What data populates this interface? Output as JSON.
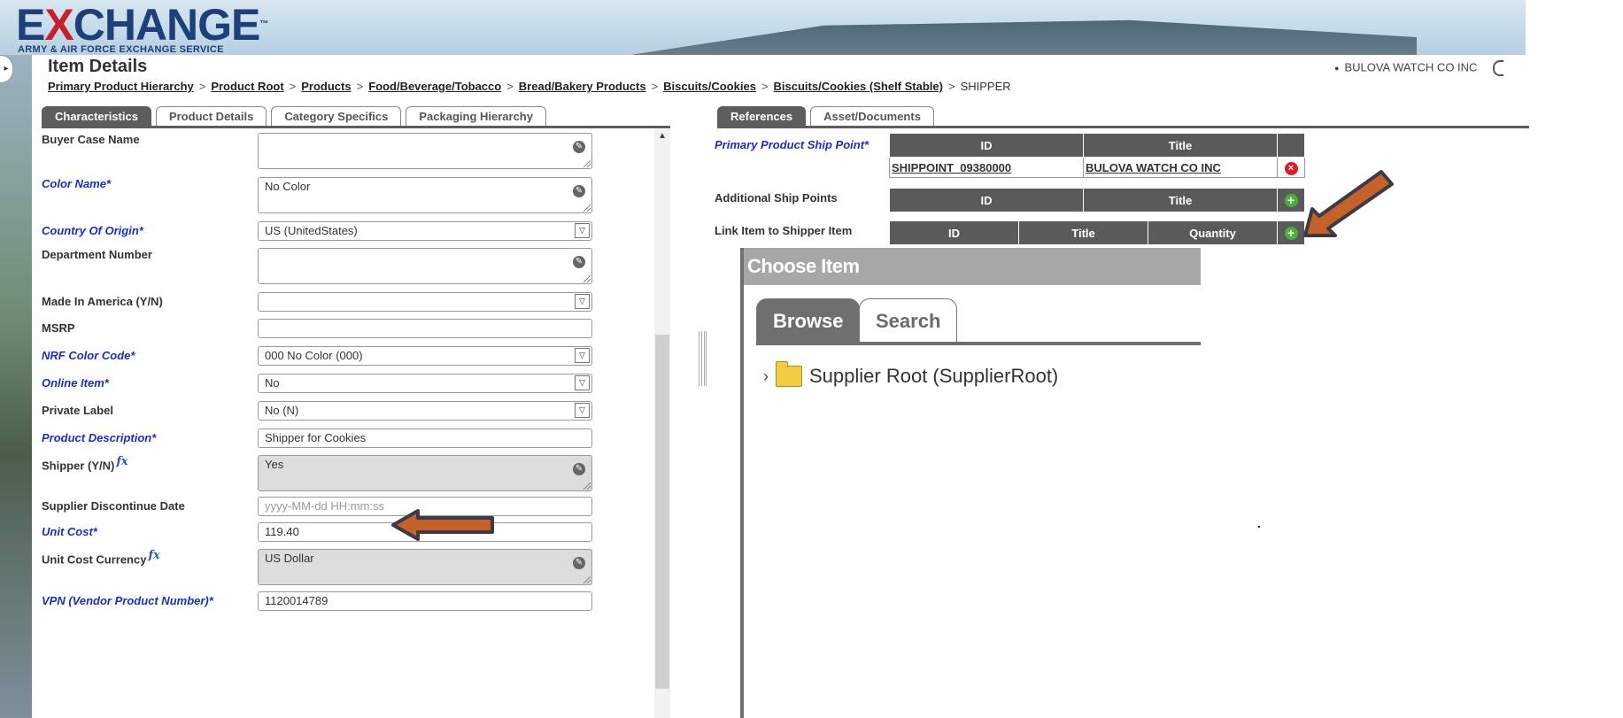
{
  "brand": {
    "logo_pre": "E",
    "logo_x": "X",
    "logo_post": "CHANGE",
    "logo_tm": "™",
    "subtitle": "ARMY & AIR FORCE EXCHANGE SERVICE"
  },
  "page": {
    "title": "Item Details",
    "supplier": "BULOVA WATCH CO INC"
  },
  "breadcrumb": [
    "Primary Product Hierarchy",
    "Product Root",
    "Products",
    "Food/Beverage/Tobacco",
    "Bread/Bakery Products",
    "Biscuits/Cookies",
    "Biscuits/Cookies (Shelf Stable)"
  ],
  "breadcrumb_current": "SHIPPER",
  "left_tabs": [
    "Characteristics",
    "Product Details",
    "Category Specifics",
    "Packaging Hierarchy"
  ],
  "right_tabs": [
    "References",
    "Asset/Documents"
  ],
  "fields": [
    {
      "label": "Buyer Case Name",
      "value": ""
    },
    {
      "label": "Color Name*",
      "value": "No Color"
    },
    {
      "label": "Country Of Origin*",
      "value": "US (UnitedStates)"
    },
    {
      "label": "Department Number",
      "value": ""
    },
    {
      "label": "Made In America (Y/N)",
      "value": ""
    },
    {
      "label": "MSRP",
      "value": ""
    },
    {
      "label": "NRF Color Code*",
      "value": "000 No Color (000)"
    },
    {
      "label": "Online Item*",
      "value": "No"
    },
    {
      "label": "Private Label",
      "value": "No (N)"
    },
    {
      "label": "Product Description*",
      "value": "Shipper for Cookies"
    },
    {
      "label": "Shipper (Y/N)",
      "value": "Yes"
    },
    {
      "label": "Supplier Discontinue Date",
      "placeholder": "yyyy-MM-dd HH:mm:ss"
    },
    {
      "label": "Unit Cost*",
      "value": "119.40"
    },
    {
      "label": "Unit Cost Currency",
      "value": "US Dollar"
    },
    {
      "label": "VPN (Vendor Product Number)*",
      "value": "1120014789"
    }
  ],
  "fx_symbol": "fx",
  "references": {
    "primary_ship_point_label": "Primary Product Ship Point*",
    "additional_ship_points_label": "Additional Ship Points",
    "link_shipper_label": "Link Item to Shipper Item",
    "col_id": "ID",
    "col_title": "Title",
    "col_quantity": "Quantity",
    "primary_row": {
      "id": "SHIPPOINT_09380000",
      "title": "BULOVA WATCH CO INC"
    }
  },
  "choose_item": {
    "title": "Choose Item",
    "tabs": [
      "Browse",
      "Search"
    ],
    "tree_root": "Supplier Root (SupplierRoot)"
  },
  "colors": {
    "required_label": "#1a2fc2",
    "header_grey": "#5a5a5a",
    "annotation_arrow": "#c4622a"
  }
}
